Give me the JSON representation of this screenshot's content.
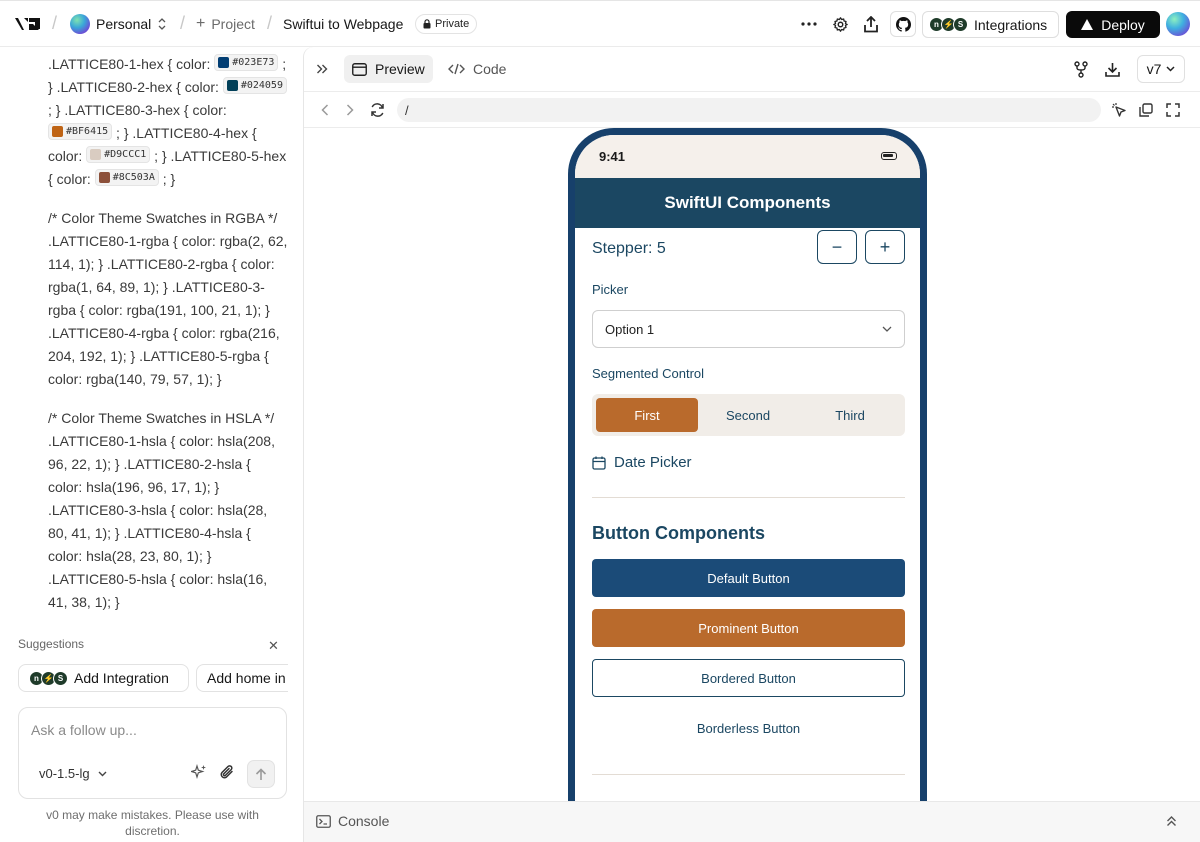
{
  "topbar": {
    "logo": "v0",
    "workspace": "Personal",
    "project_label": "Project",
    "project_name": "Swiftui to Webpage",
    "private_label": "Private",
    "integrations_label": "Integrations",
    "deploy_label": "Deploy"
  },
  "chat": {
    "hex_chips": [
      "#023E73",
      "#024059",
      "#BF6415",
      "#D9CCC1",
      "#8C503A"
    ],
    "hex_colors": [
      "#023E73",
      "#024059",
      "#BF6415",
      "#D9CCC1",
      "#8C503A"
    ],
    "hex": {
      "t1": ".LATTICE80-1-hex { color: ",
      "t2": "; } .LATTICE80-2-hex { color: ",
      "t3": "; } .LATTICE80-3-hex { color: ",
      "t4": "; } .LATTICE80-4-hex { color: ",
      "t5": "; } .LATTICE80-5-hex { color: ",
      "t6": "; }"
    },
    "rgba_block": "/* Color Theme Swatches in RGBA */ .LATTICE80-1-rgba { color: rgba(2, 62, 114, 1); } .LATTICE80-2-rgba { color: rgba(1, 64, 89, 1); } .LATTICE80-3-rgba { color: rgba(191, 100, 21, 1); } .LATTICE80-4-rgba { color: rgba(216, 204, 192, 1); } .LATTICE80-5-rgba { color: rgba(140, 79, 57, 1); }",
    "hsla_block": "/* Color Theme Swatches in HSLA */ .LATTICE80-1-hsla { color: hsla(208, 96, 22, 1); } .LATTICE80-2-hsla { color: hsla(196, 96, 17, 1); } .LATTICE80-3-hsla { color: hsla(28, 80, 41, 1); } .LATTICE80-4-hsla { color: hsla(28, 23, 80, 1); } .LATTICE80-5-hsla { color: hsla(16, 41, 38, 1); }",
    "suggestions_title": "Suggestions",
    "suggestions": [
      "Add Integration",
      "Add home in"
    ],
    "composer_placeholder": "Ask a follow up...",
    "model": "v0-1.5-lg",
    "disclaimer": "v0 may make mistakes. Please use with discretion."
  },
  "preview": {
    "tab_preview": "Preview",
    "tab_code": "Code",
    "version": "v7",
    "url": "/",
    "console_label": "Console"
  },
  "app": {
    "status_time": "9:41",
    "nav_title": "SwiftUI Components",
    "stepper_label": "Stepper: 5",
    "stepper_minus": "−",
    "stepper_plus": "+",
    "picker_label": "Picker",
    "picker_value": "Option 1",
    "segmented_label": "Segmented Control",
    "segments": [
      "First",
      "Second",
      "Third"
    ],
    "selected_segment": "First",
    "date_picker_label": "Date Picker",
    "button_section_title": "Button Components",
    "buttons": {
      "default": "Default Button",
      "prominent": "Prominent Button",
      "bordered": "Bordered Button",
      "borderless": "Borderless Button"
    }
  },
  "colors": {
    "navy": "#1b4762",
    "accent": "#b96a2c",
    "button_blue": "#1b4b78"
  }
}
